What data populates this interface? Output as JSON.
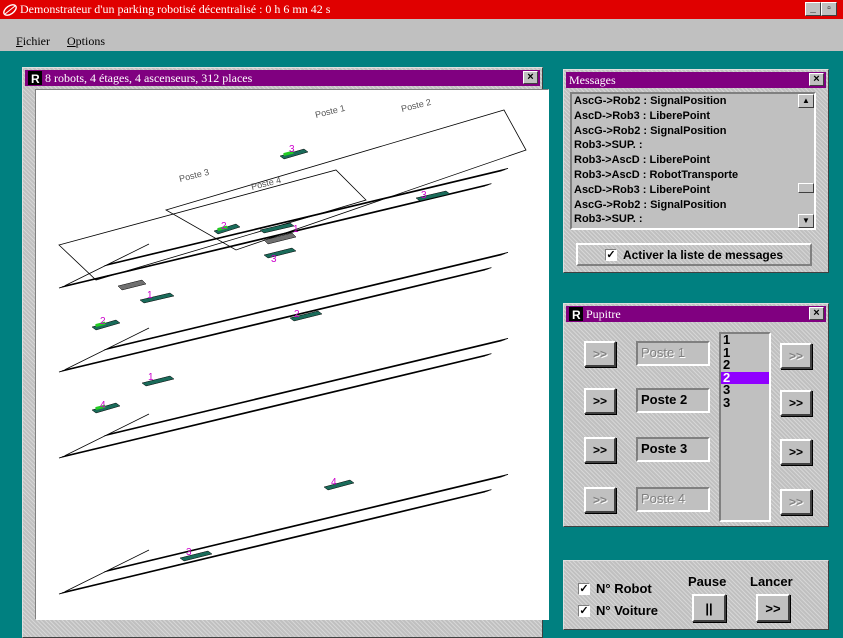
{
  "window": {
    "title": "Demonstrateur d'un parking robotisé décentralisé : 0 h 6 mn 42 s"
  },
  "menu": [
    {
      "label": "Fichier",
      "underline": "F"
    },
    {
      "label": "Options",
      "underline": "O"
    }
  ],
  "parking": {
    "title": "8 robots, 4 étages,  4 ascenseurs, 312 places",
    "station_labels": [
      "Poste 1",
      "Poste 2",
      "Poste 3",
      "Poste 4"
    ],
    "robot_numbers": [
      "3",
      "3",
      "2",
      "1",
      "3",
      "1",
      "2",
      "2",
      "1",
      "4",
      "4",
      "3"
    ]
  },
  "messages": {
    "title": "Messages",
    "lines": [
      "AscG->Rob2 : SignalPosition",
      "AscD->Rob3 : LiberePoint",
      "AscG->Rob2 : SignalPosition",
      "Rob3->SUP. :",
      "Rob3->AscD : LiberePoint",
      "Rob3->AscD : RobotTransporte",
      "AscD->Rob3 : LiberePoint",
      "AscG->Rob2 : SignalPosition",
      "Rob3->SUP. :"
    ],
    "activate_label": "Activer la liste de messages",
    "activate_checked": "✓"
  },
  "pupitre": {
    "title": "Pupitre",
    "button_label": ">>",
    "postes": [
      {
        "label": "Poste 1",
        "enabled": false
      },
      {
        "label": "Poste 2",
        "enabled": true
      },
      {
        "label": "Poste 3",
        "enabled": true
      },
      {
        "label": "Poste 4",
        "enabled": false
      }
    ],
    "queue": [
      "1",
      "1",
      "2",
      "2",
      "3",
      "3"
    ],
    "queue_selected_index": 3
  },
  "controls": {
    "robot_label": "N° Robot",
    "voiture_label": "N° Voiture",
    "robot_checked": "✓",
    "voiture_checked": "✓",
    "pause_label": "Pause",
    "pause_button": "||",
    "lancer_label": "Lancer",
    "lancer_button": ">>"
  },
  "colors": {
    "titlebar": "#e00000",
    "window_title": "#800080",
    "desktop": "#008080",
    "selection": "#9000ff",
    "robot_marker": "#1a6b5a",
    "robot_label": "#cc00cc",
    "car": "#22cc22"
  }
}
